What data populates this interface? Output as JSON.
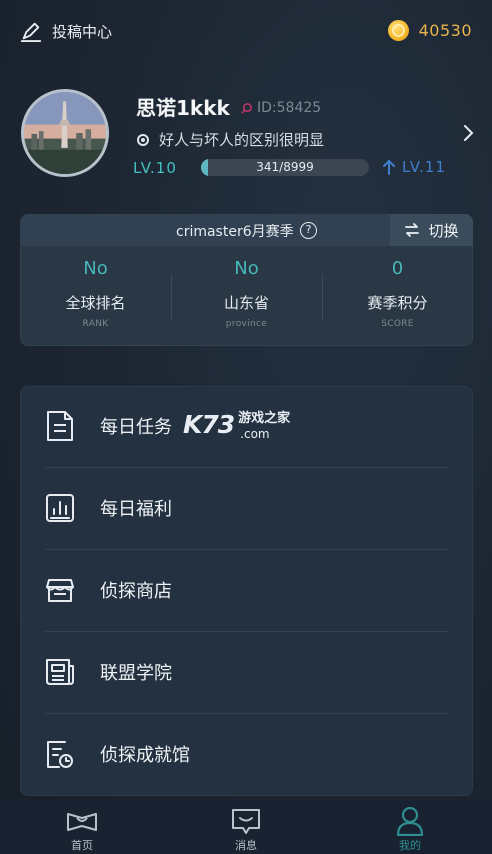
{
  "header": {
    "submit_center": "投稿中心",
    "coins": "40530",
    "icons": {
      "submit": "edit-icon",
      "coin": "coin-icon"
    }
  },
  "profile": {
    "name": "思诺1kkk",
    "id_text": "ID:58425",
    "motto": "好人与坏人的区别很明显",
    "level_current": "LV.10",
    "level_next": "LV.11",
    "xp_text": "341/8999",
    "xp_progress": 0.038
  },
  "season": {
    "title": "crimaster6月赛季",
    "switch_label": "切换",
    "stats": [
      {
        "value": "No",
        "label": "全球排名",
        "sub": "RANK"
      },
      {
        "value": "No",
        "label": "山东省",
        "sub": "province"
      },
      {
        "value": "0",
        "label": "赛季积分",
        "sub": "SCORE"
      }
    ]
  },
  "menu": {
    "items": [
      {
        "label": "每日任务",
        "icon": "document-icon"
      },
      {
        "label": "每日福利",
        "icon": "chart-icon"
      },
      {
        "label": "侦探商店",
        "icon": "store-icon"
      },
      {
        "label": "联盟学院",
        "icon": "newspaper-icon"
      },
      {
        "label": "侦探成就馆",
        "icon": "achievement-icon"
      }
    ]
  },
  "watermark": {
    "brand": "K73",
    "cn": "游戏之家",
    "com": ".com"
  },
  "tabs": [
    {
      "label": "首页",
      "icon": "home-icon",
      "active": false
    },
    {
      "label": "消息",
      "icon": "message-icon",
      "active": false
    },
    {
      "label": "我的",
      "icon": "profile-icon",
      "active": true
    }
  ],
  "colors": {
    "accent_teal": "#47b6b9",
    "coin_gold": "#e9b44d",
    "level_next_blue": "#3f7fcf",
    "tab_active": "#2e8f90",
    "tab_inactive": "#b9c2cb"
  }
}
